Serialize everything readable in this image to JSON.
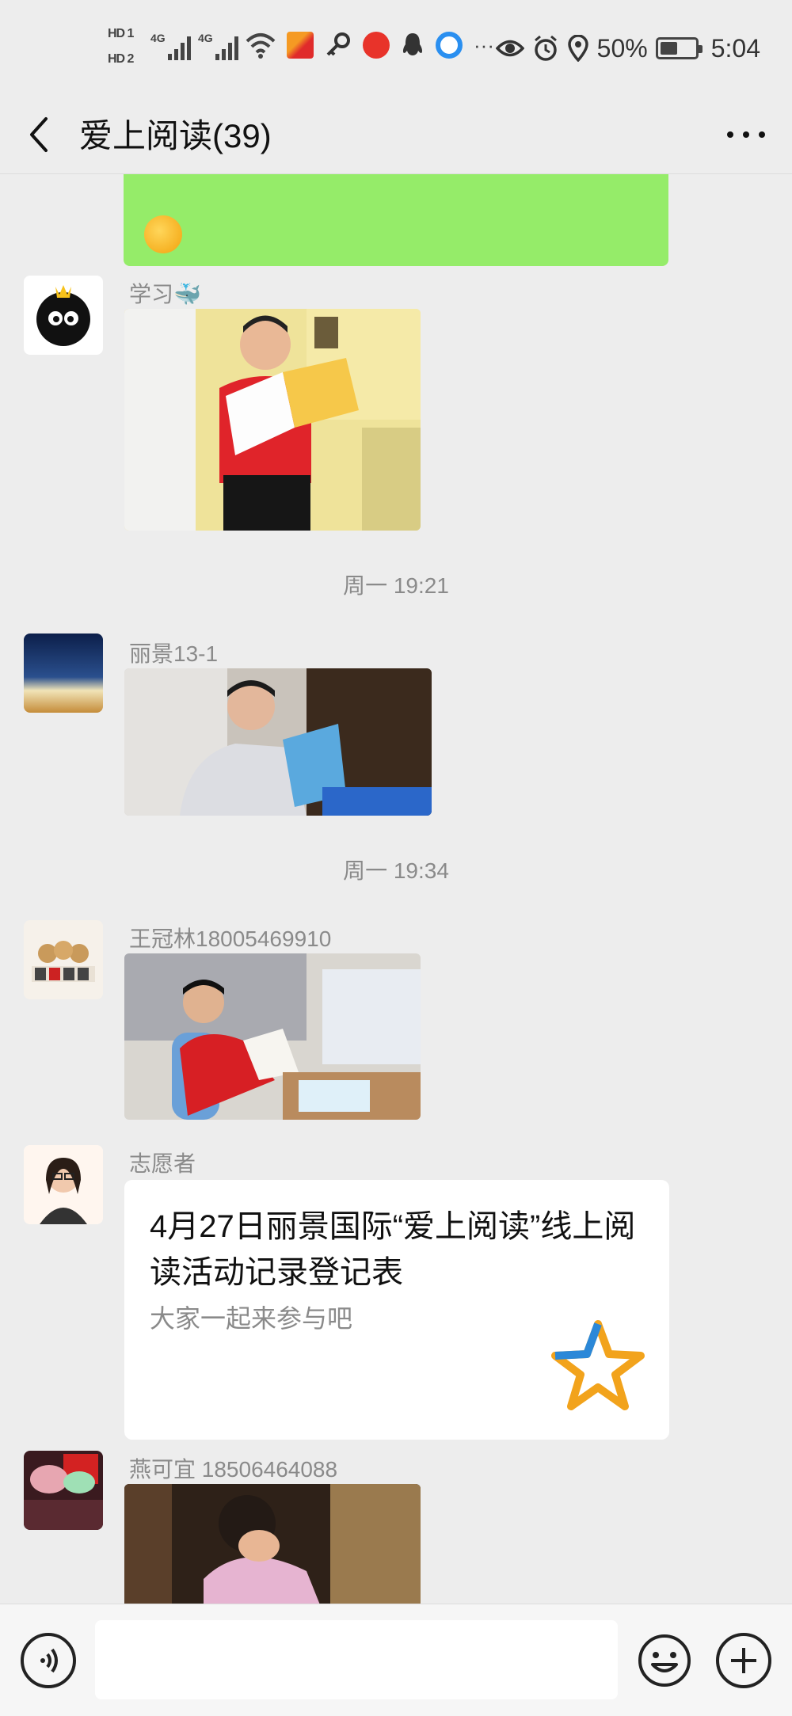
{
  "status_bar": {
    "hd1": "HD 1",
    "hd2": "HD 2",
    "net1": "4G",
    "net2": "4G",
    "dots": "···",
    "battery_percent": "50%",
    "battery_level": 0.5,
    "time": "5:04",
    "icons": [
      "wifi-icon",
      "app-icon",
      "key-icon",
      "app-icon",
      "qq-icon",
      "browser-icon",
      "eye-icon",
      "alarm-icon",
      "location-icon",
      "battery-icon"
    ]
  },
  "header": {
    "title": "爱上阅读(39)",
    "back_icon": "chevron-left-icon",
    "more_icon": "more-dots-icon"
  },
  "messages": [
    {
      "sender": "学习🐳"
    },
    {
      "timestamp": "周一 19:21"
    },
    {
      "sender": "丽景13-1"
    },
    {
      "timestamp": "周一 19:34"
    },
    {
      "sender": "王冠林18005469910"
    },
    {
      "sender": "志愿者",
      "card_title": "4月27日丽景国际“爱上阅读”线上阅读活动记录登记表",
      "card_desc": "大家一起来参与吧"
    },
    {
      "sender": "燕可宜 18506464088"
    }
  ],
  "colors": {
    "background": "#ededed",
    "bubble_green": "#95ec69",
    "card": "#ffffff",
    "meta_text": "#8a8a8a"
  },
  "input_bar": {
    "voice_icon": "voice-icon",
    "emoji_icon": "emoji-icon",
    "plus_icon": "plus-icon",
    "input_value": ""
  }
}
